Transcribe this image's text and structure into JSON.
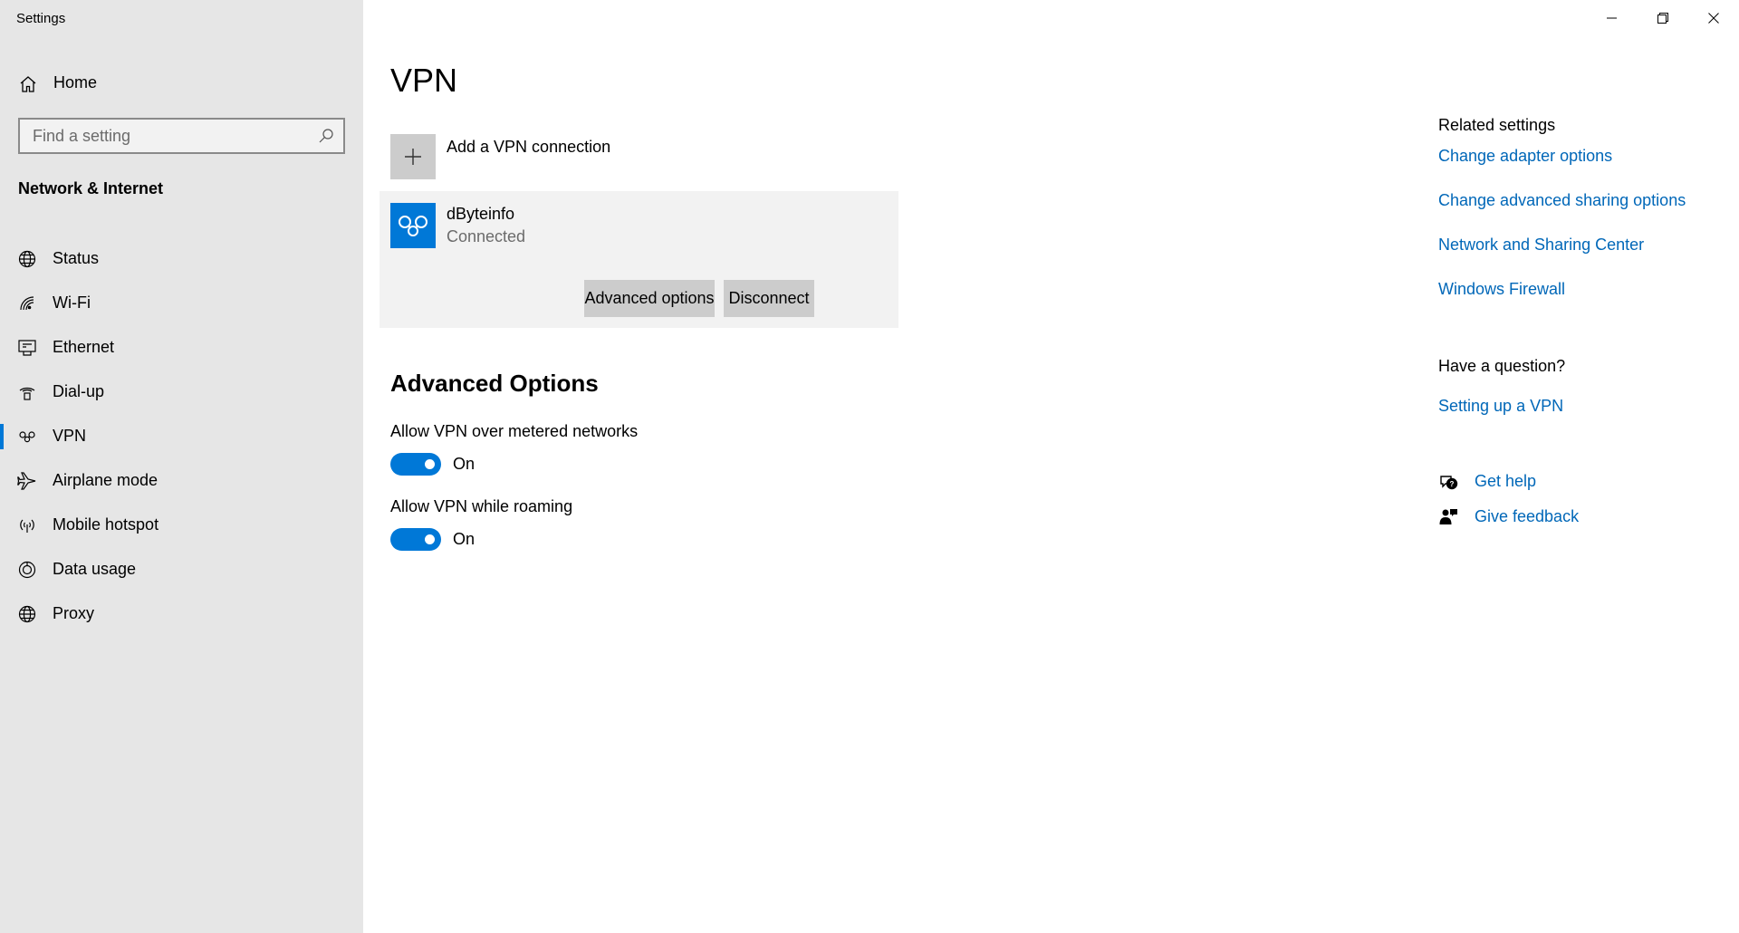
{
  "window": {
    "title": "Settings",
    "controls": [
      "minimize",
      "restore",
      "close"
    ]
  },
  "sidebar": {
    "home_label": "Home",
    "search_placeholder": "Find a setting",
    "section_title": "Network & Internet",
    "items": [
      {
        "label": "Status",
        "icon": "globe-status-icon"
      },
      {
        "label": "Wi-Fi",
        "icon": "wifi-icon"
      },
      {
        "label": "Ethernet",
        "icon": "ethernet-icon"
      },
      {
        "label": "Dial-up",
        "icon": "dialup-icon"
      },
      {
        "label": "VPN",
        "icon": "vpn-icon",
        "active": true
      },
      {
        "label": "Airplane mode",
        "icon": "airplane-icon"
      },
      {
        "label": "Mobile hotspot",
        "icon": "hotspot-icon"
      },
      {
        "label": "Data usage",
        "icon": "data-usage-icon"
      },
      {
        "label": "Proxy",
        "icon": "globe-icon"
      }
    ]
  },
  "main": {
    "title": "VPN",
    "add_vpn_label": "Add a VPN connection",
    "connection": {
      "name": "dByteinfo",
      "status": "Connected",
      "advanced_button": "Advanced options",
      "disconnect_button": "Disconnect"
    },
    "advanced": {
      "title": "Advanced Options",
      "options": [
        {
          "label": "Allow VPN over metered networks",
          "state": "On"
        },
        {
          "label": "Allow VPN while roaming",
          "state": "On"
        }
      ]
    }
  },
  "related": {
    "title": "Related settings",
    "links": [
      "Change adapter options",
      "Change advanced sharing options",
      "Network and Sharing Center",
      "Windows Firewall"
    ],
    "question_title": "Have a question?",
    "question_link": "Setting up a VPN",
    "get_help": "Get help",
    "give_feedback": "Give feedback"
  },
  "colors": {
    "accent": "#0078d7",
    "link": "#0067b8",
    "sidebar_bg": "#e6e6e6"
  }
}
